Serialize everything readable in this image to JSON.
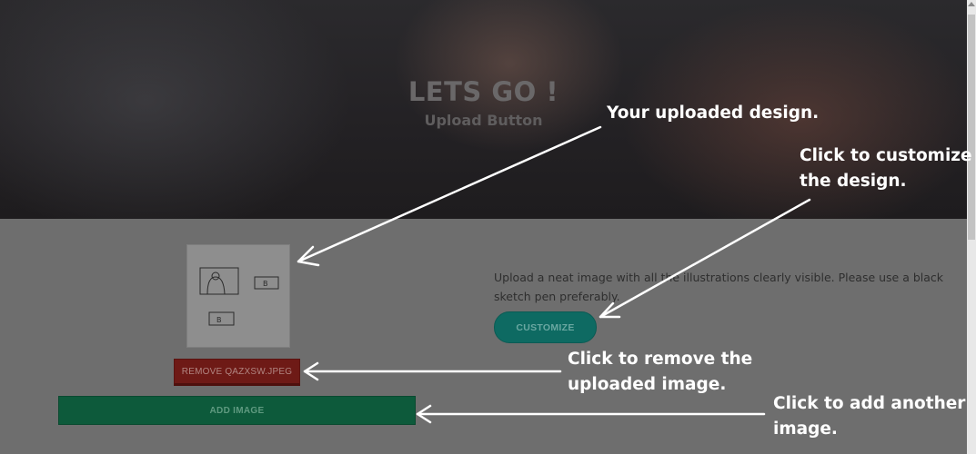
{
  "hero": {
    "title": "LETS GO !",
    "subtitle": "Upload Button"
  },
  "upload": {
    "preview_alt": "Uploaded sketch preview",
    "sketch_labels": [
      "B",
      "B"
    ],
    "description": "Upload a neat image with all the illustrations clearly visible. Please use a black sketch pen preferably.",
    "customize_label": "CUSTOMIZE",
    "remove_label": "REMOVE QAZXSW.JPEG",
    "add_label": "ADD IMAGE"
  },
  "annotations": {
    "uploaded": "Your uploaded design.",
    "customize_line1": "Click to customize",
    "customize_line2": "the design.",
    "remove_line1": "Click to remove the",
    "remove_line2": "uploaded image.",
    "add_line1": "Click to add another",
    "add_line2": "image."
  },
  "colors": {
    "overlay": "#6e6e6e",
    "customize_bg": "#0e6a62",
    "remove_bg": "#6e1a16",
    "add_bg": "#0d5a3b",
    "annotation_text": "#ffffff"
  }
}
